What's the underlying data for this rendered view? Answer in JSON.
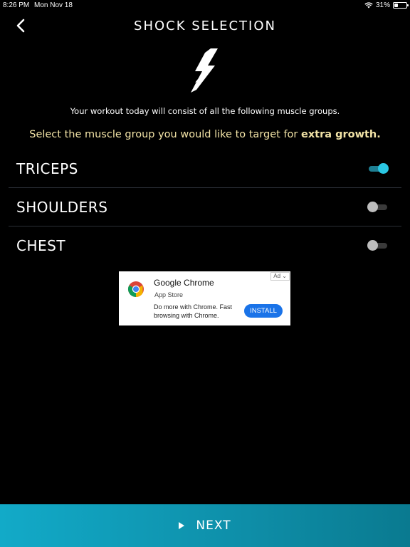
{
  "status_bar": {
    "time": "8:26 PM",
    "date": "Mon Nov 18",
    "battery_text": "31%",
    "battery_level": 0.31
  },
  "header": {
    "title": "SHOCK SELECTION",
    "back_icon": "chevron-left-icon"
  },
  "hero_icon": "lightning-bolt-icon",
  "intro_text": "Your workout today will consist of all the following muscle groups.",
  "select_text": {
    "regular": "Select the muscle group you would like to target for ",
    "bold": "extra growth."
  },
  "muscle_groups": [
    {
      "label": "TRICEPS",
      "selected": true
    },
    {
      "label": "SHOULDERS",
      "selected": false
    },
    {
      "label": "CHEST",
      "selected": false
    }
  ],
  "ad": {
    "badge": "Ad",
    "title": "Google Chrome",
    "source": "App Store",
    "description": "Do more with Chrome. Fast browsing with Chrome.",
    "install_label": "INSTALL",
    "icon": "chrome-icon"
  },
  "footer": {
    "next_label": "NEXT",
    "icon": "play-icon"
  },
  "colors": {
    "background": "#000000",
    "accent": "#2ac7e3",
    "highlight_text": "#f2e3a6",
    "next_bar": "#0e8ea8",
    "install": "#1a73e8"
  }
}
